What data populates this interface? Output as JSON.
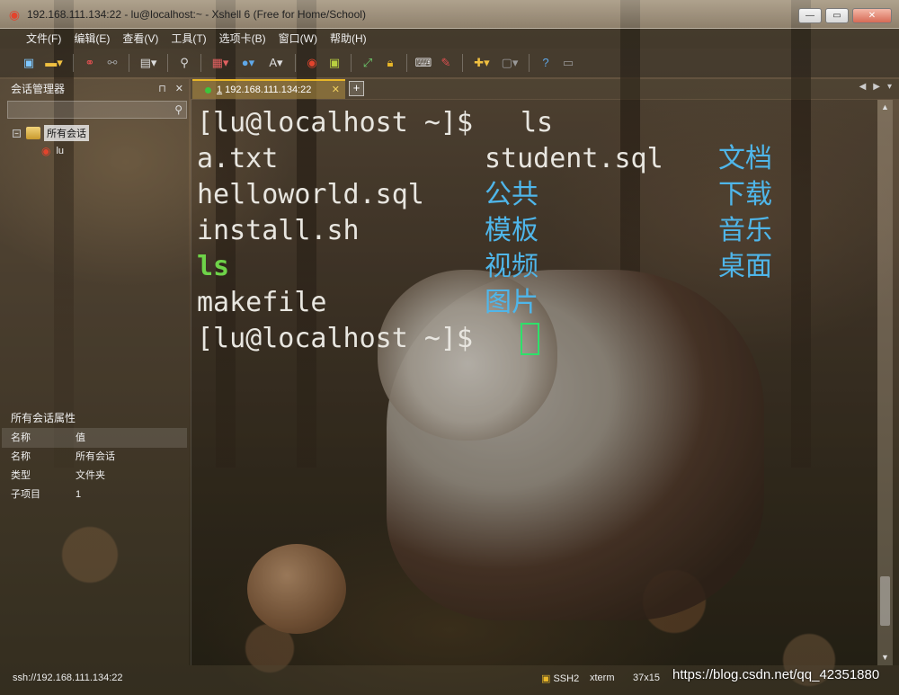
{
  "window": {
    "title": "192.168.111.134:22 - lu@localhost:~ - Xshell 6 (Free for Home/School)",
    "minimize": "—",
    "maximize": "▭",
    "close": "✕"
  },
  "menu": [
    "文件(F)",
    "编辑(E)",
    "查看(V)",
    "工具(T)",
    "选项卡(B)",
    "窗口(W)",
    "帮助(H)"
  ],
  "sidebar": {
    "title": "会话管理器",
    "pin": "⊓",
    "close": "✕",
    "search_placeholder": "",
    "root_label": "所有会话",
    "child_label": "lu"
  },
  "properties": {
    "title": "所有会话属性",
    "header_name": "名称",
    "header_value": "值",
    "rows": [
      {
        "name": "名称",
        "value": "所有会话"
      },
      {
        "name": "类型",
        "value": "文件夹"
      },
      {
        "name": "子项目",
        "value": "1"
      }
    ]
  },
  "tab": {
    "index": "1",
    "label": "192.168.111.134:22",
    "close": "✕",
    "add": "+"
  },
  "terminal": {
    "prompt": "[lu@localhost ~]$ ",
    "command": "ls",
    "rows": [
      [
        "a.txt",
        "student.sql",
        "文档"
      ],
      [
        "helloworld.sql",
        "公共",
        "下载"
      ],
      [
        "install.sh",
        "模板",
        "音乐"
      ],
      [
        "ls",
        "视频",
        "桌面"
      ],
      [
        "makefile",
        "图片",
        ""
      ]
    ],
    "executable": "ls",
    "colors": {
      "text": "#e8e6e0",
      "directory": "#4fb6ea",
      "executable": "#6ed349",
      "cursor": "#2ee06a"
    }
  },
  "status": {
    "connection": "ssh://192.168.111.134:22",
    "protocol": "SSH2",
    "terminal_type": "xterm",
    "size": "37x15",
    "watermark": "https://blog.csdn.net/qq_42351880"
  }
}
